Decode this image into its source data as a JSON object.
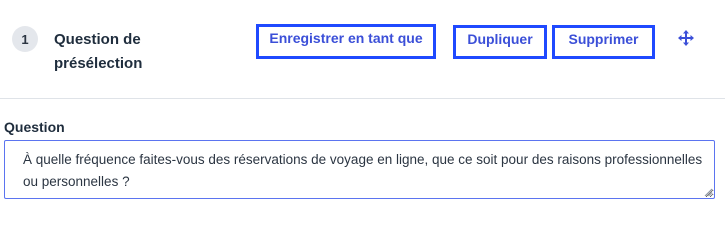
{
  "step": {
    "number": "1",
    "title": "Question de présélection"
  },
  "actions": {
    "save_as_label": "Enregistrer en tant que",
    "duplicate_label": "Dupliquer",
    "delete_label": "Supprimer"
  },
  "icons": {
    "move": "move-arrows-icon"
  },
  "question": {
    "label": "Question",
    "value": "À quelle fréquence faites-vous des réservations de voyage en ligne, que ce soit pour des raisons professionnelles ou personnelles ?"
  },
  "colors": {
    "accent": "#3b4fd8",
    "highlight_border": "#1f49ff",
    "badge_bg": "#e4e7ec"
  }
}
